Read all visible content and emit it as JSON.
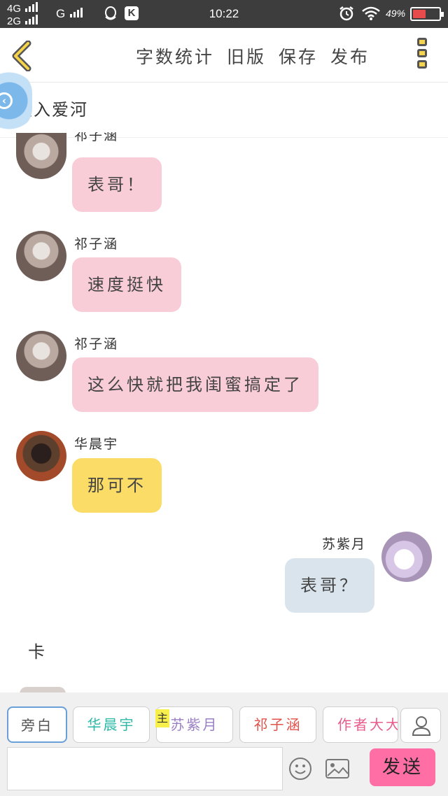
{
  "status_bar": {
    "network1": "4G",
    "network2": "2G",
    "network3": "G",
    "app_badge": "K",
    "time": "10:22",
    "battery_pct": "49%",
    "battery_level": 0.49,
    "battery_color": "#e84b4b"
  },
  "toolbar": {
    "back_icon": "chevron-left-icon",
    "items": [
      "字数统计",
      "旧版",
      "保存",
      "发布"
    ],
    "more_icon": "kebab-menu-icon"
  },
  "chapter": {
    "title": "坠入爱河"
  },
  "messages": [
    {
      "speaker": "祁子涵",
      "text": "表哥！",
      "color": "#f8cdd8"
    },
    {
      "speaker": "祁子涵",
      "text": "速度挺快",
      "color": "#f8cdd8"
    },
    {
      "speaker": "祁子涵",
      "text": "这么快就把我闺蜜搞定了",
      "color": "#f8cdd8"
    },
    {
      "speaker": "华晨宇",
      "text": "那可不",
      "color": "#fadc66"
    },
    {
      "speaker": "苏紫月",
      "text": "表哥？",
      "color": "#d9e4ec"
    }
  ],
  "narration": "卡",
  "characters": [
    {
      "label": "旁白",
      "color": "#555555",
      "selected": true
    },
    {
      "label": "华晨宇",
      "color": "#2bb8a6"
    },
    {
      "label": "苏紫月",
      "color": "#9a7fc4",
      "badge": "主"
    },
    {
      "label": "祁子涵",
      "color": "#e0524a"
    },
    {
      "label": "作者大大",
      "color": "#e85c8c"
    }
  ],
  "composer": {
    "placeholder": "",
    "send_label": "发送",
    "send_color": "#ff6fa6"
  }
}
